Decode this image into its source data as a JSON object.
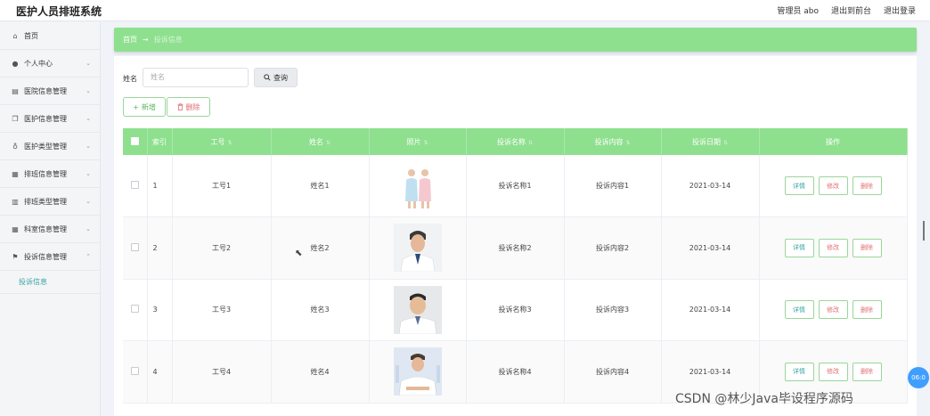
{
  "app": {
    "title": "医护人员排班系统",
    "admin_label": "管理员 abo",
    "to_front": "退出到前台",
    "logout": "退出登录"
  },
  "sidebar": {
    "items": [
      {
        "label": "首页",
        "icon": "home-icon",
        "glyph": "⌂",
        "chevron": ""
      },
      {
        "label": "个人中心",
        "icon": "user-icon",
        "glyph": "●",
        "chevron": "⌄"
      },
      {
        "label": "医院信息管理",
        "icon": "document-icon",
        "glyph": "▤",
        "chevron": "⌄"
      },
      {
        "label": "医护信息管理",
        "icon": "copy-icon",
        "glyph": "❐",
        "chevron": "⌄"
      },
      {
        "label": "医护类型管理",
        "icon": "microphone-icon",
        "glyph": "♁",
        "chevron": "⌄"
      },
      {
        "label": "排班信息管理",
        "icon": "clipboard-icon",
        "glyph": "▦",
        "chevron": "⌄"
      },
      {
        "label": "排班类型管理",
        "icon": "chart-icon",
        "glyph": "▥",
        "chevron": "⌄"
      },
      {
        "label": "科室信息管理",
        "icon": "grid-icon",
        "glyph": "▦",
        "chevron": "⌄"
      },
      {
        "label": "投诉信息管理",
        "icon": "flag-icon",
        "glyph": "⚑",
        "chevron": "⌃"
      }
    ],
    "sub_item": "投诉信息"
  },
  "breadcrumb": {
    "home": "首页",
    "arrow": "→",
    "current": "投诉信息"
  },
  "search": {
    "label": "姓名",
    "placeholder": "姓名",
    "button": "查询"
  },
  "actions": {
    "add": "新增",
    "delete": "删除"
  },
  "table": {
    "headers": [
      "索引",
      "工号",
      "姓名",
      "照片",
      "投诉名称",
      "投诉内容",
      "投诉日期",
      "操作"
    ],
    "ops": {
      "detail": "详情",
      "edit": "修改",
      "delete": "删除"
    },
    "rows": [
      {
        "idx": "1",
        "no": "工号1",
        "name": "姓名1",
        "title": "投诉名称1",
        "content": "投诉内容1",
        "date": "2021-03-14"
      },
      {
        "idx": "2",
        "no": "工号2",
        "name": "姓名2",
        "title": "投诉名称2",
        "content": "投诉内容2",
        "date": "2021-03-14"
      },
      {
        "idx": "3",
        "no": "工号3",
        "name": "姓名3",
        "title": "投诉名称3",
        "content": "投诉内容3",
        "date": "2021-03-14"
      },
      {
        "idx": "4",
        "no": "工号4",
        "name": "姓名4",
        "title": "投诉名称4",
        "content": "投诉内容4",
        "date": "2021-03-14"
      }
    ]
  },
  "overlay": {
    "badge": "06:0",
    "watermark": "CSDN @林少Java毕设程序源码"
  },
  "colors": {
    "accent": "#8ee08e",
    "teal": "#3aa3a3",
    "danger": "#e07070"
  }
}
